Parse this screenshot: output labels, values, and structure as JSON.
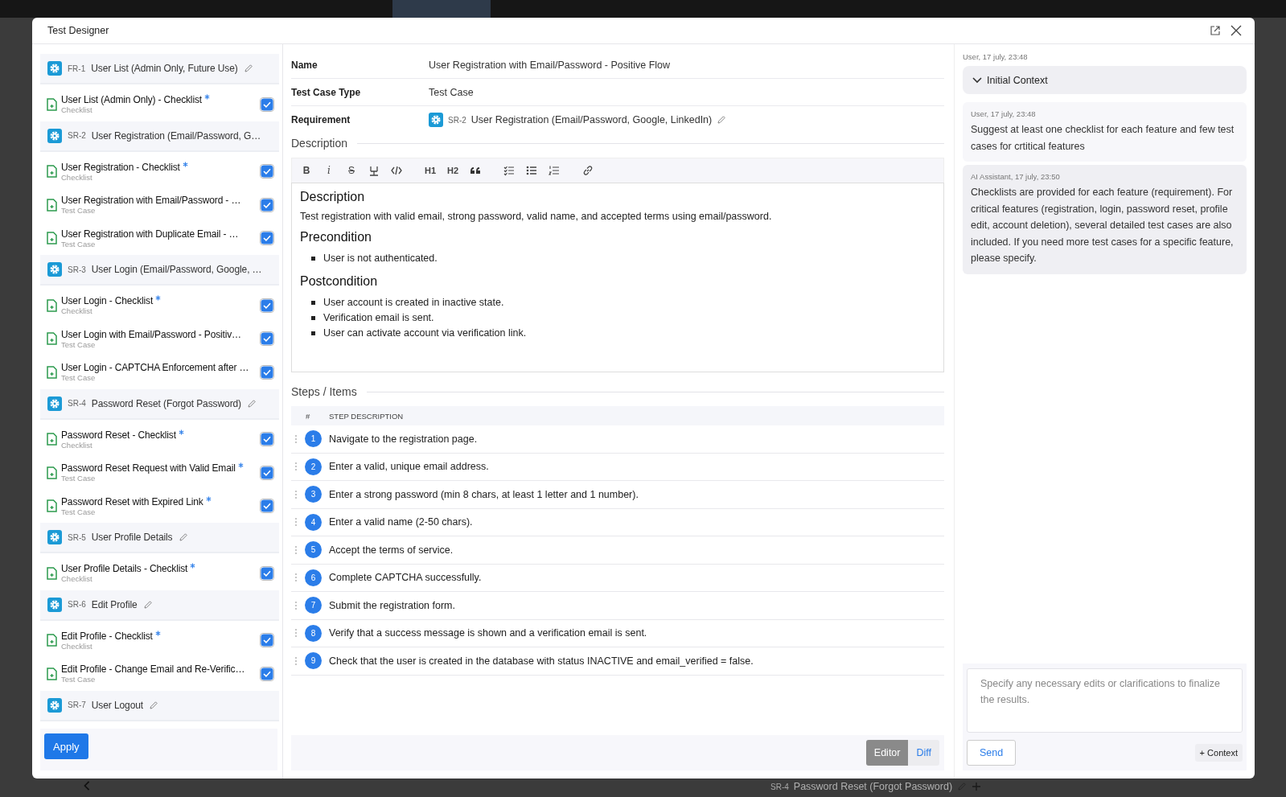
{
  "window": {
    "title": "Test Designer"
  },
  "background": {
    "footer_requirement": {
      "code": "SR-4",
      "title": "Password Reset (Forgot Password)"
    }
  },
  "test_list": {
    "items": [
      {
        "kind": "requirement",
        "code": "FR-1",
        "title": "User List (Admin Only, Future Use)",
        "editable": true
      },
      {
        "kind": "test",
        "title": "User List (Admin Only) - Checklist",
        "type": "Checklist",
        "starred": true,
        "checked": true
      },
      {
        "kind": "requirement",
        "code": "SR-2",
        "title": "User Registration (Email/Password, G…",
        "editable": false
      },
      {
        "kind": "test",
        "title": "User Registration - Checklist",
        "type": "Checklist",
        "starred": true,
        "checked": true
      },
      {
        "kind": "test",
        "title": "User Registration with Email/Password - …",
        "type": "Test Case",
        "starred": false,
        "checked": true
      },
      {
        "kind": "test",
        "title": "User Registration with Duplicate Email - …",
        "type": "Test Case",
        "starred": false,
        "checked": true
      },
      {
        "kind": "requirement",
        "code": "SR-3",
        "title": "User Login (Email/Password, Google, …",
        "editable": false
      },
      {
        "kind": "test",
        "title": "User Login - Checklist",
        "type": "Checklist",
        "starred": true,
        "checked": true
      },
      {
        "kind": "test",
        "title": "User Login with Email/Password - Positiv…",
        "type": "Test Case",
        "starred": false,
        "checked": true
      },
      {
        "kind": "test",
        "title": "User Login - CAPTCHA Enforcement after …",
        "type": "Test Case",
        "starred": false,
        "checked": true
      },
      {
        "kind": "requirement",
        "code": "SR-4",
        "title": "Password Reset (Forgot Password)",
        "editable": true
      },
      {
        "kind": "test",
        "title": "Password Reset - Checklist",
        "type": "Checklist",
        "starred": true,
        "checked": true
      },
      {
        "kind": "test",
        "title": "Password Reset Request with Valid Email",
        "type": "Test Case",
        "starred": true,
        "checked": true
      },
      {
        "kind": "test",
        "title": "Password Reset with Expired Link",
        "type": "Test Case",
        "starred": true,
        "checked": true
      },
      {
        "kind": "requirement",
        "code": "SR-5",
        "title": "User Profile Details",
        "editable": true
      },
      {
        "kind": "test",
        "title": "User Profile Details - Checklist",
        "type": "Checklist",
        "starred": true,
        "checked": true
      },
      {
        "kind": "requirement",
        "code": "SR-6",
        "title": "Edit Profile",
        "editable": true
      },
      {
        "kind": "test",
        "title": "Edit Profile - Checklist",
        "type": "Checklist",
        "starred": true,
        "checked": true
      },
      {
        "kind": "test",
        "title": "Edit Profile - Change Email and Re-Verific…",
        "type": "Test Case",
        "starred": false,
        "checked": true
      },
      {
        "kind": "requirement",
        "code": "SR-7",
        "title": "User Logout",
        "editable": true
      }
    ]
  },
  "apply_button": "Apply",
  "details": {
    "fields": [
      {
        "kind": "text",
        "label": "Name",
        "value": "User Registration with Email/Password - Positive Flow"
      },
      {
        "kind": "text",
        "label": "Test Case Type",
        "value": "Test Case"
      },
      {
        "kind": "requirement",
        "label": "Requirement",
        "code": "SR-2",
        "value": "User Registration (Email/Password, Google, LinkedIn)",
        "editable": true
      }
    ],
    "description_heading": "Description",
    "toolbar": [
      {
        "kind": "bold",
        "label": "B"
      },
      {
        "kind": "italic",
        "label": "i"
      },
      {
        "kind": "strike",
        "label": "S"
      },
      {
        "kind": "clear"
      },
      {
        "kind": "code"
      },
      {
        "kind": "sep"
      },
      {
        "kind": "heading",
        "label": "H1"
      },
      {
        "kind": "heading",
        "label": "H2"
      },
      {
        "kind": "quote"
      },
      {
        "kind": "sep"
      },
      {
        "kind": "checklist"
      },
      {
        "kind": "bullets"
      },
      {
        "kind": "numbers"
      },
      {
        "kind": "sep"
      },
      {
        "kind": "link"
      }
    ],
    "content": [
      {
        "kind": "heading",
        "text": "Description"
      },
      {
        "kind": "paragraph",
        "text": "Test registration with valid email, strong password, valid name, and accepted terms using email/password."
      },
      {
        "kind": "heading",
        "text": "Precondition"
      },
      {
        "kind": "list",
        "items": [
          "User is not authenticated."
        ]
      },
      {
        "kind": "heading",
        "text": "Postcondition"
      },
      {
        "kind": "list",
        "items": [
          "User account is created in inactive state.",
          "Verification email is sent.",
          "User can activate account via verification link."
        ]
      }
    ],
    "steps_heading": "Steps / Items",
    "steps": {
      "columns": [
        "#",
        "STEP DESCRIPTION"
      ],
      "rows": [
        {
          "number": "1",
          "text": "Navigate to the registration page."
        },
        {
          "number": "2",
          "text": "Enter a valid, unique email address."
        },
        {
          "number": "3",
          "text": "Enter a strong password (min 8 chars, at least 1 letter and 1 number)."
        },
        {
          "number": "4",
          "text": "Enter a valid name (2-50 chars)."
        },
        {
          "number": "5",
          "text": "Accept the terms of service."
        },
        {
          "number": "6",
          "text": "Complete CAPTCHA successfully."
        },
        {
          "number": "7",
          "text": "Submit the registration form."
        },
        {
          "number": "8",
          "text": "Verify that a success message is shown and a verification email is sent."
        },
        {
          "number": "9",
          "text": "Check that the user is created in the database with status INACTIVE and email_verified = false."
        }
      ]
    },
    "view_toggle": [
      {
        "label": "Editor",
        "selected": true
      },
      {
        "label": "Diff",
        "selected": false
      }
    ]
  },
  "chat": {
    "context": {
      "meta": "User, 17 july, 23:48",
      "label": "Initial Context"
    },
    "messages": [
      {
        "kind": "user",
        "meta": "User, 17 july, 23:48",
        "text": "Suggest at least one checklist for each feature and few test cases for crtitical features"
      },
      {
        "kind": "assistant",
        "meta": "AI Assistant, 17 july, 23:50",
        "text": "Checklists are provided for each feature (requirement). For critical features (registration, login, password reset, profile edit, account deletion), several detailed test cases are also included. If you need more test cases for a specific feature, please specify."
      }
    ],
    "input": {
      "placeholder": "Specify any necessary edits or clarifications to finalize the results."
    },
    "send_button": "Send",
    "context_button": "+ Context"
  }
}
